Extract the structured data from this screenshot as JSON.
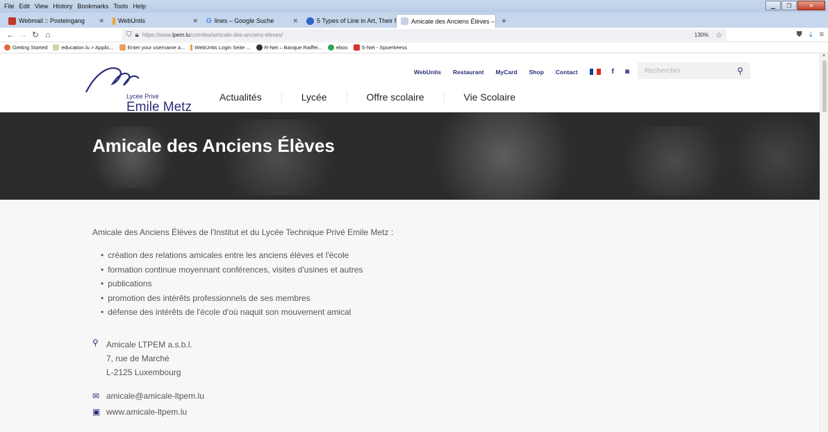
{
  "menubar": [
    "File",
    "Edit",
    "View",
    "History",
    "Bookmarks",
    "Tools",
    "Help"
  ],
  "tabs": [
    {
      "title": "Webmail :: Posteingang",
      "color": "#c0392b"
    },
    {
      "title": "WebUntis",
      "color": "#f0a030"
    },
    {
      "title": "lines – Google Suche",
      "color": "#4285f4"
    },
    {
      "title": "5 Types of Line in Art, Their Me",
      "color": "#2a66c8"
    },
    {
      "title": "Amicale des Anciens Élèves – L",
      "color": "#c9cfe4"
    }
  ],
  "url": {
    "prefix": "https://www.",
    "host": "lpem.lu",
    "path": "/comites/amicale-des-anciens-eleves/",
    "zoom": "130%"
  },
  "bookmarks": [
    {
      "label": "Getting Started",
      "color": "#e8643a"
    },
    {
      "label": "education.lu > Applic...",
      "color": "#cfd8a5"
    },
    {
      "label": "Enter your username a...",
      "color": "#e8a060"
    },
    {
      "label": "WebUntis Login Seite ...",
      "color": "#f0a030"
    },
    {
      "label": "R-Net – Banque Raiffei...",
      "color": "#333333"
    },
    {
      "label": "eboo",
      "color": "#2fa84f"
    },
    {
      "label": "S-Net - Spuerkeess",
      "color": "#d6342c"
    }
  ],
  "logo": {
    "line1": "Lycée Privé",
    "line2": "Emile Metz"
  },
  "main_nav": [
    "Actualités",
    "Lycée",
    "Offre scolaire",
    "Vie Scolaire"
  ],
  "top_nav": [
    "WebUntis",
    "Restaurant",
    "MyCard",
    "Shop",
    "Contact"
  ],
  "search": {
    "placeholder": "Rechercher"
  },
  "hero_title": "Amicale des Anciens Élèves",
  "intro": "Amicale des Anciens Élèves de l'Institut et du Lycée Technique Privé Emile Metz :",
  "bullets": [
    "création des relations amicales entre les anciens élèves et l'école",
    "formation continue moyennant conférences, visites d'usines et autres",
    "publications",
    "promotion des intérêts professionnels de ses membres",
    "défense des intérêts de l'école d'où naquit son mouvement amical"
  ],
  "address": [
    "Amicale LTPEM a.s.b.l.",
    "7, rue de Marché",
    "L-2125 Luxembourg"
  ],
  "email": "amicale@amicale-ltpem.lu",
  "website": "www.amicale-ltpem.lu",
  "colors": {
    "brand": "#2b2f7a",
    "hero_bg": "#2c2c2c",
    "content_bg": "#f7f7f7"
  }
}
